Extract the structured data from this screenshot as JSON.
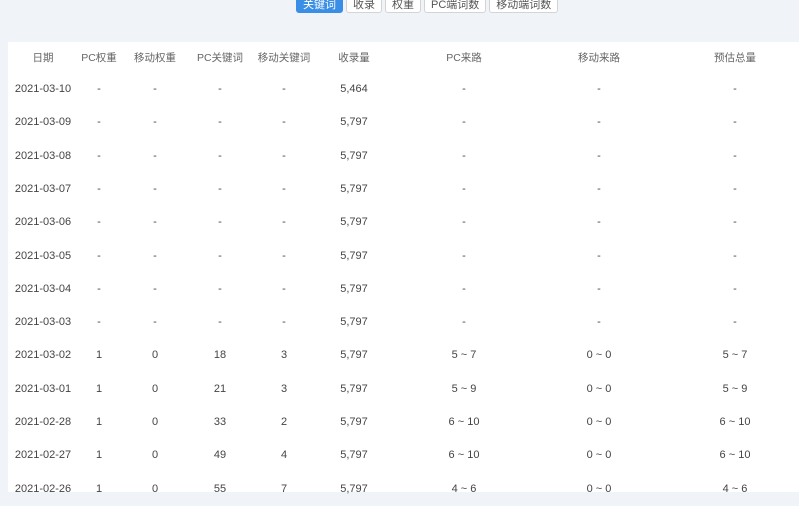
{
  "tabs": [
    {
      "label": "关键词",
      "active": true
    },
    {
      "label": "收录"
    },
    {
      "label": "权重"
    },
    {
      "label": "PC端词数"
    },
    {
      "label": "移动端词数"
    }
  ],
  "columns": [
    "日期",
    "PC权重",
    "移动权重",
    "PC关键词",
    "移动关键词",
    "收录量",
    "PC来路",
    "移动来路",
    "预估总量"
  ],
  "rows": [
    [
      "2021-03-10",
      "-",
      "-",
      "-",
      "-",
      "5,464",
      "-",
      "-",
      "-"
    ],
    [
      "2021-03-09",
      "-",
      "-",
      "-",
      "-",
      "5,797",
      "-",
      "-",
      "-"
    ],
    [
      "2021-03-08",
      "-",
      "-",
      "-",
      "-",
      "5,797",
      "-",
      "-",
      "-"
    ],
    [
      "2021-03-07",
      "-",
      "-",
      "-",
      "-",
      "5,797",
      "-",
      "-",
      "-"
    ],
    [
      "2021-03-06",
      "-",
      "-",
      "-",
      "-",
      "5,797",
      "-",
      "-",
      "-"
    ],
    [
      "2021-03-05",
      "-",
      "-",
      "-",
      "-",
      "5,797",
      "-",
      "-",
      "-"
    ],
    [
      "2021-03-04",
      "-",
      "-",
      "-",
      "-",
      "5,797",
      "-",
      "-",
      "-"
    ],
    [
      "2021-03-03",
      "-",
      "-",
      "-",
      "-",
      "5,797",
      "-",
      "-",
      "-"
    ],
    [
      "2021-03-02",
      "1",
      "0",
      "18",
      "3",
      "5,797",
      "5 ~ 7",
      "0 ~ 0",
      "5 ~ 7"
    ],
    [
      "2021-03-01",
      "1",
      "0",
      "21",
      "3",
      "5,797",
      "5 ~ 9",
      "0 ~ 0",
      "5 ~ 9"
    ],
    [
      "2021-02-28",
      "1",
      "0",
      "33",
      "2",
      "5,797",
      "6 ~ 10",
      "0 ~ 0",
      "6 ~ 10"
    ],
    [
      "2021-02-27",
      "1",
      "0",
      "49",
      "4",
      "5,797",
      "6 ~ 10",
      "0 ~ 0",
      "6 ~ 10"
    ],
    [
      "2021-02-26",
      "1",
      "0",
      "55",
      "7",
      "5,797",
      "4 ~ 6",
      "0 ~ 0",
      "4 ~ 6"
    ]
  ]
}
